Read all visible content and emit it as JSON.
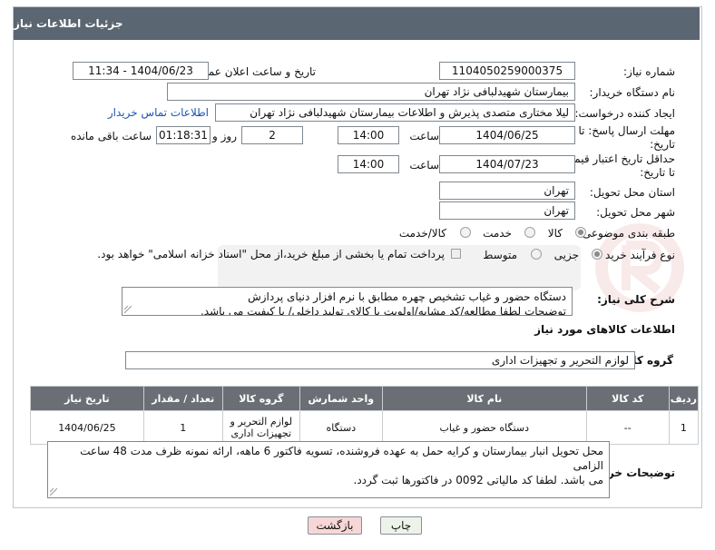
{
  "header": {
    "title": "جزئیات اطلاعات نیاز"
  },
  "fields": {
    "need_number_label": "شماره نیاز:",
    "need_number": "1104050259000375",
    "announce_label": "تاریخ و ساعت اعلان عمومی:",
    "announce_value": "1404/06/23 - 11:34",
    "buyer_label": "نام دستگاه خریدار:",
    "buyer_value": "بیمارستان شهیدلبافی نژاد تهران",
    "creator_label": "ایجاد کننده درخواست:",
    "creator_value": "لیلا مختاری متصدی پذیرش و اطلاعات بیمارستان شهیدلبافی نژاد تهران",
    "contact_link": "اطلاعات تماس خریدار",
    "deadline_label_1": "مهلت ارسال پاسخ: تا",
    "deadline_label_2": "تاریخ:",
    "deadline_date": "1404/06/25",
    "time_label": "ساعت",
    "deadline_time": "14:00",
    "days_value": "2",
    "days_label": "روز و",
    "remaining_value": "01:18:31",
    "remaining_label": "ساعت باقی مانده",
    "validity_label_1": "حداقل تاریخ اعتبار قیمت:",
    "validity_label_2": "تا تاریخ:",
    "validity_date": "1404/07/23",
    "validity_time": "14:00",
    "province_label": "استان محل تحویل:",
    "province_value": "تهران",
    "city_label": "شهر محل تحویل:",
    "city_value": "تهران",
    "category_label": "طبقه بندی موضوعی:",
    "category_options": [
      "کالا",
      "خدمت",
      "کالا/خدمت"
    ],
    "category_selected": "کالا",
    "process_label": "نوع فرآیند خرید :",
    "process_options": [
      "جزیی",
      "متوسط"
    ],
    "process_selected": "جزیی",
    "payment_note": "پرداخت تمام یا بخشی از مبلغ خرید،از محل \"اسناد خزانه اسلامی\" خواهد بود."
  },
  "description": {
    "label": "شرح کلی نیاز:",
    "line1": "دستگاه حضور و غیاب تشخیص چهره مطابق با نرم افزار دنیای پردازش",
    "line2": "توضیحات لطفا مطالعه/کد مشابه/اولویت با کالای تولید داخلی/ با کیفیت می باشد."
  },
  "goods": {
    "section_title": "اطلاعات کالاهای مورد نیاز",
    "group_label": "گروه کالا:",
    "group_value": "لوازم التحریر و تجهیزات اداری",
    "columns": [
      "ردیف",
      "کد کالا",
      "نام کالا",
      "واحد شمارش",
      "گروه کالا",
      "تعداد / مقدار",
      "تاریخ نیاز"
    ],
    "rows": [
      {
        "row": "1",
        "code": "--",
        "name": "دستگاه حضور و غیاب",
        "unit": "دستگاه",
        "group_line1": "لوازم التحریر و",
        "group_line2": "تجهیزات اداری",
        "qty": "1",
        "date": "1404/06/25"
      }
    ]
  },
  "buyer_notes": {
    "label": "توضیحات خریدار:",
    "line1": "محل تحویل انبار بیمارستان و کرایه حمل به عهده فروشنده، تسویه فاکتور 6 ماهه، ارائه نمونه ظرف مدت 48 ساعت الزامی",
    "line2": "می باشد. لطفا کد مالیاتی 0092 در فاکتورها ثبت گردد."
  },
  "buttons": {
    "print": "چاپ",
    "back": "بازگشت"
  },
  "colors": {
    "header_bg": "#5a6672",
    "table_header_bg": "#6b6f75",
    "link": "#1a55b5",
    "back_button_bg": "#f7d6d6",
    "print_button_bg": "#eef3ea"
  }
}
